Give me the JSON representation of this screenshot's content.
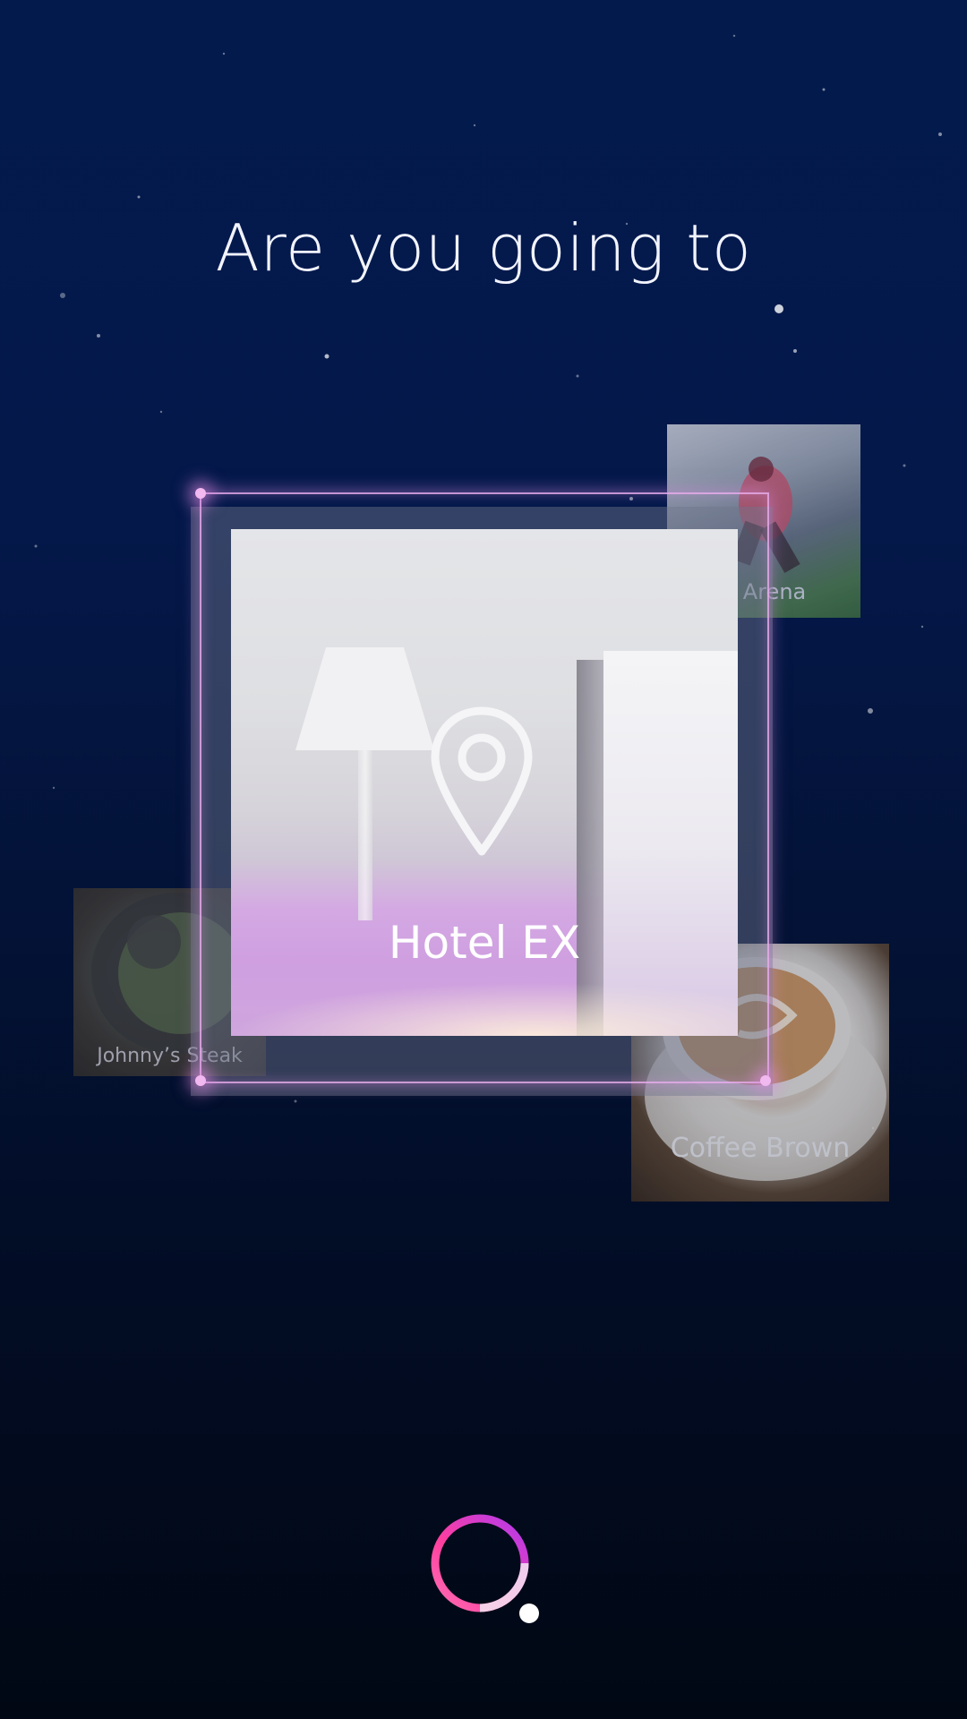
{
  "prompt": {
    "title": "Are you going to"
  },
  "selected_place": {
    "label": "Hotel EX",
    "icon": "location-pin-icon"
  },
  "other_places": [
    {
      "label": "A Arena"
    },
    {
      "label": "Johnny’s Steak"
    },
    {
      "label": "Coffee Brown"
    }
  ],
  "voice_button": {
    "icon": "voice-assistant-ring-icon"
  },
  "colors": {
    "background_top": "#031a4d",
    "background_bottom": "#010814",
    "accent_glow": "#e6a6ea",
    "ring_gradient": [
      "#d21fd6",
      "#ff4fa8",
      "#9d3df0"
    ]
  }
}
